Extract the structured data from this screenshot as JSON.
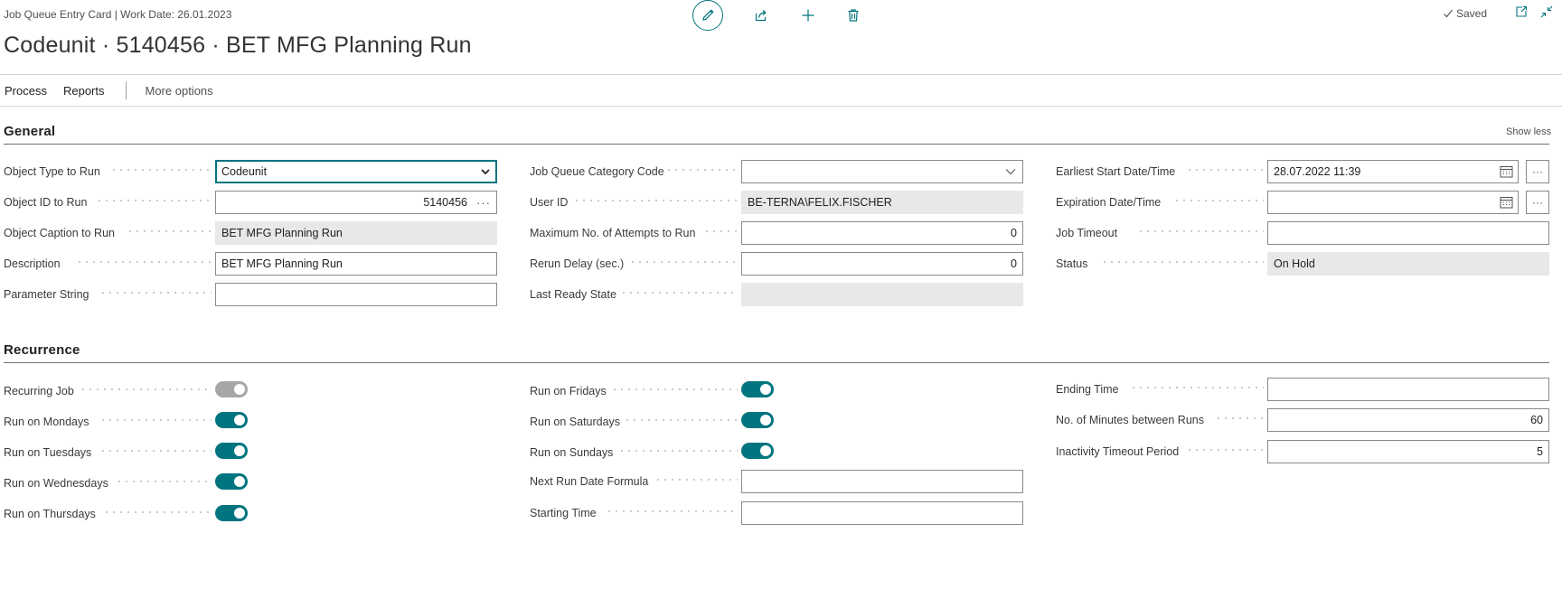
{
  "header": {
    "breadcrumb": "Job Queue Entry Card | Work Date: 26.01.2023",
    "title": "Codeunit · 5140456 · BET MFG Planning Run",
    "saved_label": "Saved"
  },
  "actions": {
    "icons": [
      "edit-icon",
      "share-icon",
      "new-icon",
      "delete-icon",
      "check-icon",
      "open-new-window-icon",
      "collapse-icon"
    ]
  },
  "menu": {
    "process": "Process",
    "reports": "Reports",
    "more": "More options"
  },
  "general": {
    "title": "General",
    "show_less": "Show less",
    "col1": {
      "object_type_label": "Object Type to Run",
      "object_type_value": "Codeunit",
      "object_id_label": "Object ID to Run",
      "object_id_value": "5140456",
      "object_caption_label": "Object Caption to Run",
      "object_caption_value": "BET MFG Planning Run",
      "description_label": "Description",
      "description_value": "BET MFG Planning Run",
      "parameter_label": "Parameter String",
      "parameter_value": ""
    },
    "col2": {
      "category_label": "Job Queue Category Code",
      "category_value": "",
      "user_id_label": "User ID",
      "user_id_value": "BE-TERNA\\FELIX.FISCHER",
      "max_attempts_label": "Maximum No. of Attempts to Run",
      "max_attempts_value": "0",
      "rerun_delay_label": "Rerun Delay (sec.)",
      "rerun_delay_value": "0",
      "last_ready_label": "Last Ready State",
      "last_ready_value": ""
    },
    "col3": {
      "earliest_start_label": "Earliest Start Date/Time",
      "earliest_start_value": "28.07.2022 11:39",
      "expiration_label": "Expiration Date/Time",
      "expiration_value": "",
      "timeout_label": "Job Timeout",
      "timeout_value": "",
      "status_label": "Status",
      "status_value": "On Hold"
    }
  },
  "recurrence": {
    "title": "Recurrence",
    "col1": {
      "recurring_label": "Recurring Job",
      "recurring_on": false,
      "mondays_label": "Run on Mondays",
      "mondays_on": true,
      "tuesdays_label": "Run on Tuesdays",
      "tuesdays_on": true,
      "wednesdays_label": "Run on Wednesdays",
      "wednesdays_on": true,
      "thursdays_label": "Run on Thursdays",
      "thursdays_on": true
    },
    "col2": {
      "fridays_label": "Run on Fridays",
      "fridays_on": true,
      "saturdays_label": "Run on Saturdays",
      "saturdays_on": true,
      "sundays_label": "Run on Sundays",
      "sundays_on": true,
      "next_run_formula_label": "Next Run Date Formula",
      "next_run_formula_value": "",
      "starting_time_label": "Starting Time",
      "starting_time_value": ""
    },
    "col3": {
      "ending_time_label": "Ending Time",
      "ending_time_value": "",
      "minutes_between_label": "No. of Minutes between Runs",
      "minutes_between_value": "60",
      "inactivity_label": "Inactivity Timeout Period",
      "inactivity_value": "5"
    }
  },
  "colors": {
    "accent": "#00757f",
    "toggle_off": "#a6a6a6",
    "readonly_bg": "#e8e8e8"
  }
}
